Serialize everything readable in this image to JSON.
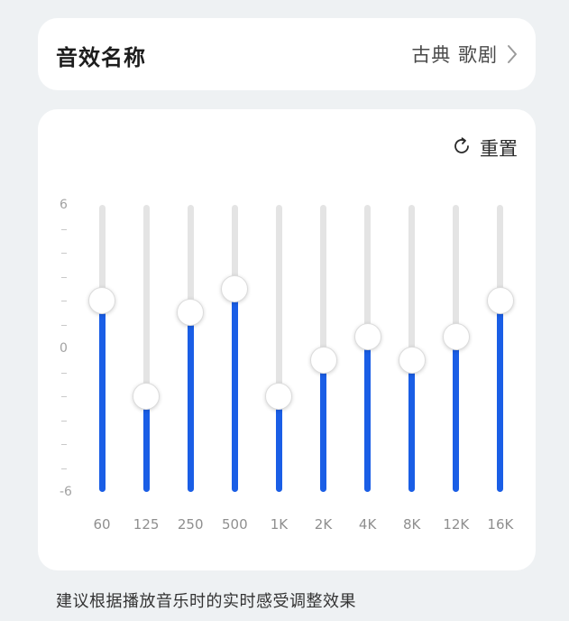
{
  "effect_name": {
    "title": "音效名称",
    "value": "古典 歌剧",
    "icon": "chevron-right-icon"
  },
  "equalizer": {
    "reset_label": "重置",
    "reset_icon": "reset-icon",
    "y_axis": {
      "max_label": "6",
      "zero_label": "0",
      "min_label": "-6",
      "range": [
        -6,
        6
      ]
    },
    "accent_color": "#1a5ee6",
    "track_color": "#e4e4e4",
    "bands": [
      {
        "label": "60",
        "gain": 2.0
      },
      {
        "label": "125",
        "gain": -2.0
      },
      {
        "label": "250",
        "gain": 1.5
      },
      {
        "label": "500",
        "gain": 2.5
      },
      {
        "label": "1K",
        "gain": -2.0
      },
      {
        "label": "2K",
        "gain": -0.5
      },
      {
        "label": "4K",
        "gain": 0.5
      },
      {
        "label": "8K",
        "gain": -0.5
      },
      {
        "label": "12K",
        "gain": 0.5
      },
      {
        "label": "16K",
        "gain": 2.0
      }
    ]
  },
  "hint": "建议根据播放音乐时的实时感受调整效果"
}
